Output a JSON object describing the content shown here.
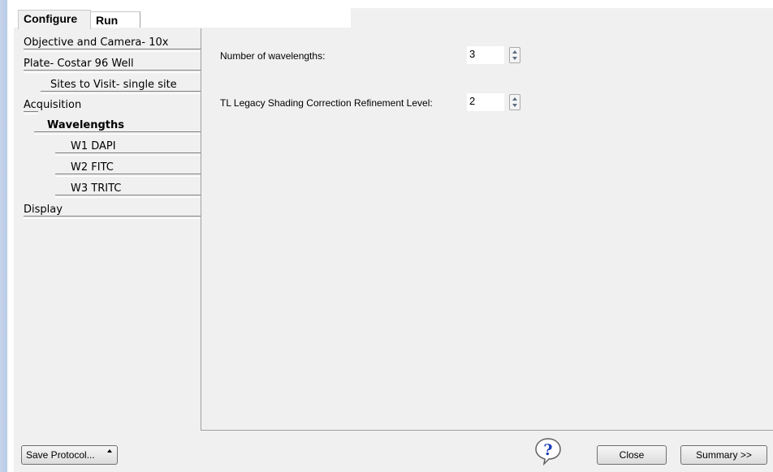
{
  "tabs": [
    {
      "label": "Configure",
      "active": true
    },
    {
      "label": "Run",
      "active": false
    }
  ],
  "nav": {
    "items": [
      {
        "label": "Objective and Camera- 10x",
        "level": 0,
        "bold": false
      },
      {
        "label": "Plate- Costar 96 Well",
        "level": 0,
        "bold": false
      },
      {
        "label": "Sites to Visit- single site",
        "level": 1,
        "bold": false
      },
      {
        "label": "Acquisition",
        "level": 0,
        "bold": false
      },
      {
        "label": "Wavelengths",
        "level": 1,
        "bold": true
      },
      {
        "label": "W1 DAPI",
        "level": 2,
        "bold": false
      },
      {
        "label": "W2 FITC",
        "level": 2,
        "bold": false
      },
      {
        "label": "W3 TRITC",
        "level": 2,
        "bold": false
      },
      {
        "label": "Display",
        "level": 0,
        "bold": false
      }
    ]
  },
  "fields": {
    "num_wavelengths": {
      "label": "Number of wavelengths:",
      "value": "3"
    },
    "shading_level": {
      "label": "TL Legacy Shading Correction Refinement Level:",
      "value": "2"
    }
  },
  "footer": {
    "save_label": "Save Protocol...",
    "close_label": "Close",
    "summary_label": "Summary >>",
    "help_icon": "help-question-icon"
  },
  "colors": {
    "panel": "#f0f0f0",
    "accent_bar": "#c7d5ea"
  }
}
